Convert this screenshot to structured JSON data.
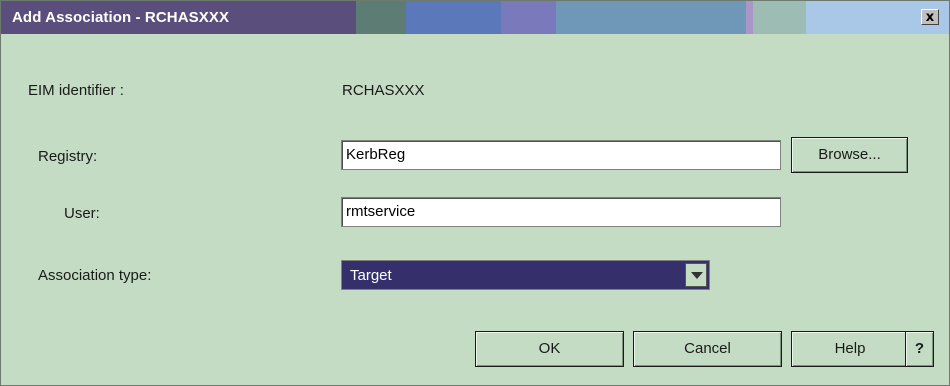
{
  "window": {
    "title": "Add Association - RCHASXXX",
    "close_glyph": "x"
  },
  "form": {
    "eim_label": "EIM identifier :",
    "eim_value": "RCHASXXX",
    "registry_label": "Registry:",
    "registry_value": "KerbReg",
    "user_label": "User:",
    "user_value": "rmtservice",
    "assoc_label": "Association type:",
    "assoc_value": "Target"
  },
  "buttons": {
    "browse": "Browse...",
    "ok": "OK",
    "cancel": "Cancel",
    "help": "Help",
    "question": "?"
  },
  "colors": {
    "background": "#c4dcc4",
    "select_bg": "#35306b",
    "title_text": "#ffffff"
  }
}
